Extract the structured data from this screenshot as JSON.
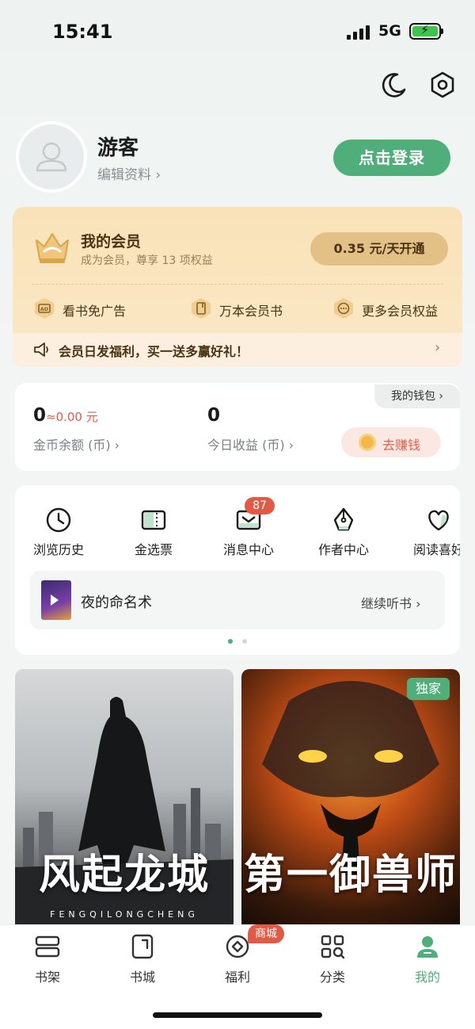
{
  "status_bar": {
    "time": "15:41",
    "network": "5G"
  },
  "profile": {
    "name": "游客",
    "edit_link": "编辑资料 ›",
    "login_button": "点击登录"
  },
  "membership": {
    "title": "我的会员",
    "subtitle": "成为会员，尊享 13 项权益",
    "price_button": "0.35 元/天开通",
    "perks": [
      {
        "label": "看书免广告",
        "icon": "ad-free-icon"
      },
      {
        "label": "万本会员书",
        "icon": "book-icon"
      },
      {
        "label": "更多会员权益",
        "icon": "more-icon"
      }
    ],
    "promo": "会员日发福利，买一送多赢好礼！",
    "promo_arrow": "›"
  },
  "wallet": {
    "tab_label": "我的钱包 ›",
    "coin_balance": "0",
    "coin_rmb": "≈0.00 元",
    "coin_label": "金币余额 (币) ›",
    "today_earnings": "0",
    "today_label": "今日收益 (币) ›",
    "earn_button": "去赚钱"
  },
  "tools": [
    {
      "label": "浏览历史",
      "icon": "clock-icon"
    },
    {
      "label": "金选票",
      "icon": "ticket-icon"
    },
    {
      "label": "消息中心",
      "icon": "message-icon",
      "badge": "87"
    },
    {
      "label": "作者中心",
      "icon": "pen-icon"
    },
    {
      "label": "阅读喜好",
      "icon": "heart-icon"
    }
  ],
  "listening": {
    "title": "夜的命名术",
    "action": "继续听书 ›"
  },
  "carousel": {
    "pages": 2,
    "active": 0
  },
  "books": [
    {
      "title": "风起龙城",
      "pinyin": "FENGQILONGCHENG",
      "badge": ""
    },
    {
      "title": "第一御兽师",
      "pinyin": "",
      "badge": "独家"
    }
  ],
  "tabbar": [
    {
      "label": "书架",
      "icon": "bookshelf-icon",
      "active": false
    },
    {
      "label": "书城",
      "icon": "bookstore-icon",
      "active": false
    },
    {
      "label": "福利",
      "icon": "welfare-icon",
      "active": false,
      "badge": "商城"
    },
    {
      "label": "分类",
      "icon": "category-icon",
      "active": false
    },
    {
      "label": "我的",
      "icon": "profile-icon",
      "active": true
    }
  ],
  "colors": {
    "accent": "#4fae7a",
    "badge_red": "#e05a45",
    "vip_gold": "#e3c085",
    "vip_text": "#4a3312"
  }
}
